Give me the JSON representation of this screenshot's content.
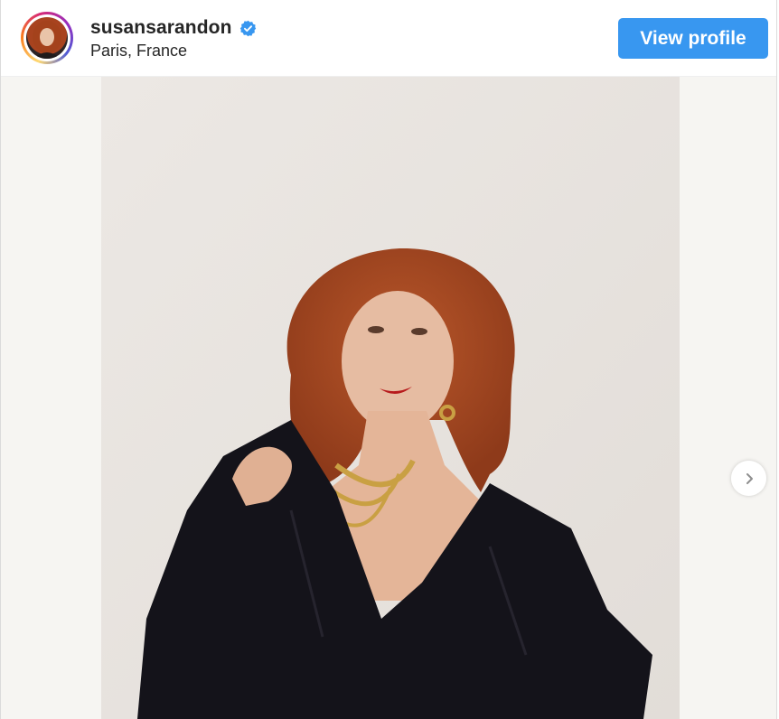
{
  "post": {
    "username": "susansarandon",
    "location": "Paris, France",
    "view_profile_label": "View profile"
  },
  "icons": {
    "verified": "verified-badge-icon",
    "next": "chevron-right-icon"
  },
  "colors": {
    "primary_button": "#3897f0",
    "verified_badge": "#3897f0",
    "text": "#262626"
  }
}
